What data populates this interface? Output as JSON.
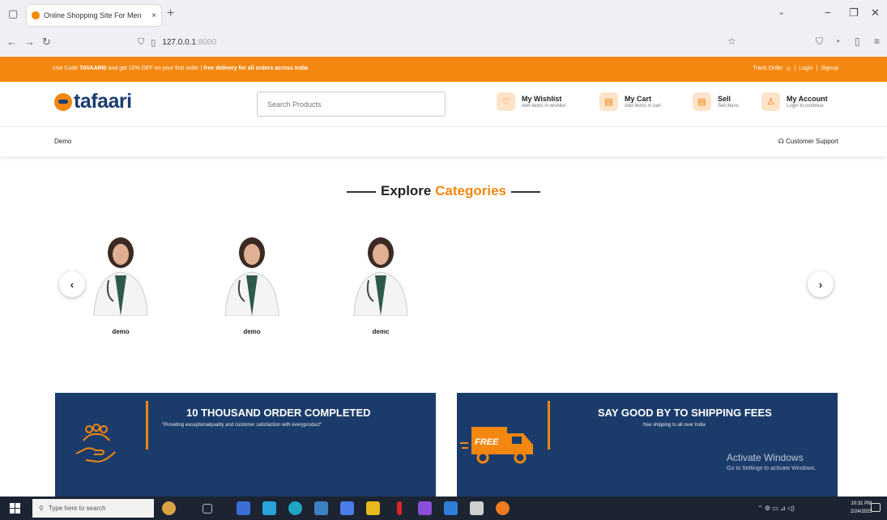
{
  "browser": {
    "tab_title": "Online Shopping Site For Men",
    "tab_close": "×",
    "new_tab": "+",
    "url_ip": "127.0.0.1",
    "url_port": ":8000",
    "win_minimize": "−",
    "win_restore": "❐",
    "win_close": "✕"
  },
  "promo": {
    "code_prefix": "Use Code",
    "code": "TAVAARI0",
    "offer_text": "and get 10% OFF on your first order",
    "separator": "|",
    "delivery_text": "free delivery for all orders across India",
    "track_order": "Track Order",
    "login": "Login",
    "signup": "Signup"
  },
  "header": {
    "logo_text": "tafaari",
    "search_placeholder": "Search Products",
    "items": [
      {
        "title": "My Wishlist",
        "subtitle": "Add items in wishlist",
        "icon": "heart-icon"
      },
      {
        "title": "My Cart",
        "subtitle": "Add items in cart",
        "icon": "cart-icon"
      },
      {
        "title": "Sell",
        "subtitle": "Sell items",
        "icon": "sell-icon"
      },
      {
        "title": "My Account",
        "subtitle": "Login to continue",
        "icon": "user-icon"
      }
    ]
  },
  "menu": {
    "demo": "Demo",
    "support": "Customer Support"
  },
  "categories": {
    "title_main": "Explore",
    "title_accent": "Categories",
    "prev": "‹",
    "next": "›",
    "items": [
      {
        "label": "demo"
      },
      {
        "label": "demo"
      },
      {
        "label": "demc"
      }
    ]
  },
  "banners": [
    {
      "heading": "10 THOUSAND ORDER COMPLETED",
      "sub": "\"Providing exceptionalquality and customer satisfaction with everyproduct\"",
      "icon": "people-hand-icon"
    },
    {
      "heading": "SAY GOOD BY TO SHIPPING FEES",
      "sub": "free shipping to all over India",
      "icon": "delivery-truck-icon",
      "truck_text": "FREE"
    }
  ],
  "watermark": {
    "line1": "Activate Windows",
    "line2": "Go to Settings to activate Windows."
  },
  "taskbar": {
    "search_placeholder": "Type here to search",
    "time": "10:31 PM",
    "date": "2/24/2025"
  }
}
